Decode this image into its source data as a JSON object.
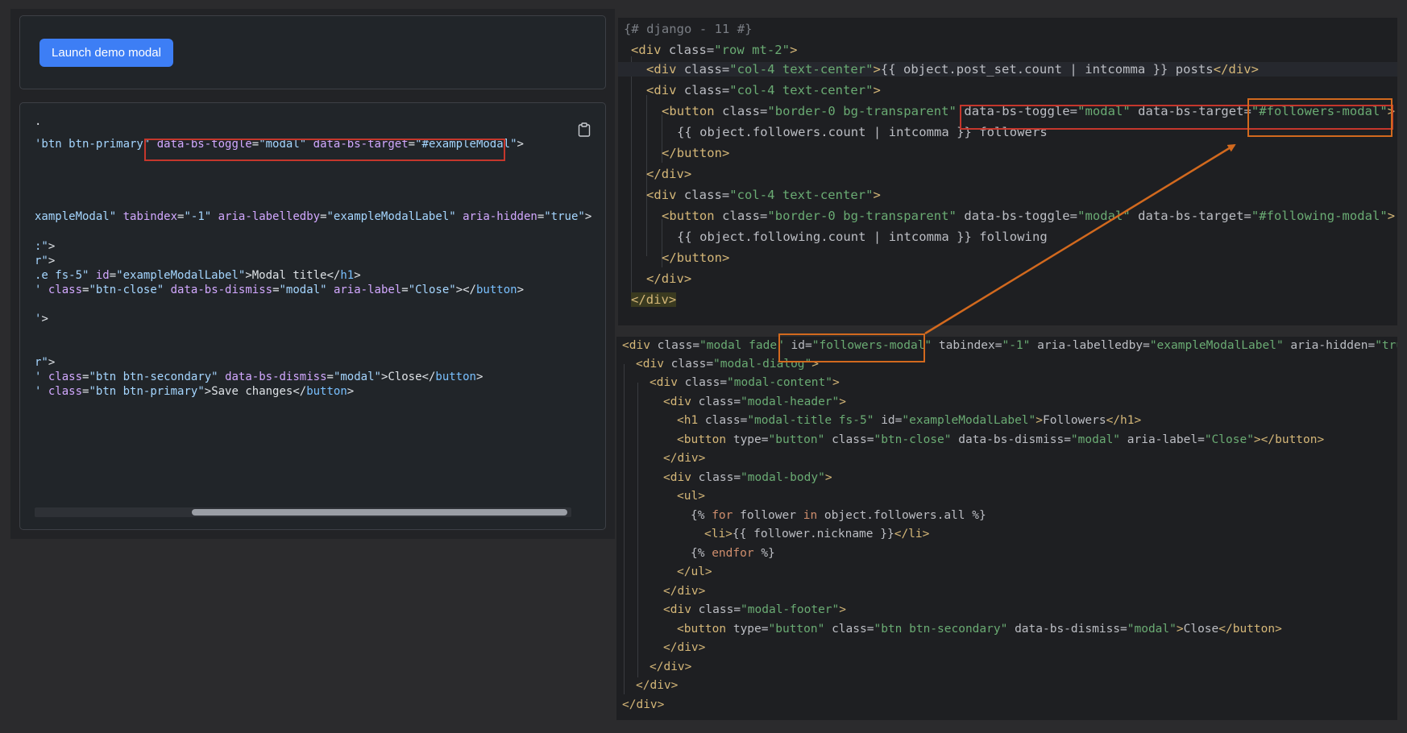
{
  "left_panel": {
    "launch_button_label": "Launch demo modal",
    "code_lines": [
      {
        "text": "."
      },
      {
        "text": "'btn btn-primary\" data-bs-toggle=\"modal\" data-bs-target=\"#exampleModal\">"
      },
      {
        "text": "xampleModal\" tabindex=\"-1\" aria-labelledby=\"exampleModalLabel\" aria-hidden=\"true\">"
      },
      {
        "text": ":\">"
      },
      {
        "text": "r\">"
      },
      {
        "text": ".e fs-5\" id=\"exampleModalLabel\">Modal title</h1>"
      },
      {
        "text": "' class=\"btn-close\" data-bs-dismiss=\"modal\" aria-label=\"Close\"></button>"
      },
      {
        "text": "'>"
      },
      {
        "text": "r\">"
      },
      {
        "text": "' class=\"btn btn-secondary\" data-bs-dismiss=\"modal\">Close</button>"
      },
      {
        "text": "' class=\"btn btn-primary\">Save changes</button>"
      }
    ]
  },
  "ide_top": {
    "comment": "{# django - 11 #}",
    "lines": [
      "<div class=\"row mt-2\">",
      "<div class=\"col-4 text-center\">{{ object.post_set.count | intcomma }} posts</div>",
      "<div class=\"col-4 text-center\">",
      "<button class=\"border-0 bg-transparent\" data-bs-toggle=\"modal\" data-bs-target=\"#followers-modal\">",
      "{{ object.followers.count | intcomma }} followers",
      "</button>",
      "</div>",
      "<div class=\"col-4 text-center\">",
      "<button class=\"border-0 bg-transparent\" data-bs-toggle=\"modal\" data-bs-target=\"#following-modal\">",
      "{{ object.following.count | intcomma }} following",
      "</button>",
      "</div>",
      "</div>"
    ]
  },
  "ide_bottom": {
    "lines": [
      "<div class=\"modal fade\" id=\"followers-modal\" tabindex=\"-1\" aria-labelledby=\"exampleModalLabel\" aria-hidden=\"true\">",
      "<div class=\"modal-dialog\">",
      "<div class=\"modal-content\">",
      "<div class=\"modal-header\">",
      "<h1 class=\"modal-title fs-5\" id=\"exampleModalLabel\">Followers</h1>",
      "<button type=\"button\" class=\"btn-close\" data-bs-dismiss=\"modal\" aria-label=\"Close\"></button>",
      "</div>",
      "<div class=\"modal-body\">",
      "<ul>",
      "{% for follower in object.followers.all %}",
      "<li>{{ follower.nickname }}</li>",
      "{% endfor %}",
      "</ul>",
      "</div>",
      "<div class=\"modal-footer\">",
      "<button type=\"button\" class=\"btn btn-secondary\" data-bs-dismiss=\"modal\">Close</button>",
      "</div>",
      "</div>",
      "</div>",
      "</div>"
    ]
  },
  "colors": {
    "accent_button": "#3d7ef5",
    "red_highlight": "#c5372c",
    "orange_highlight": "#d2691e"
  }
}
